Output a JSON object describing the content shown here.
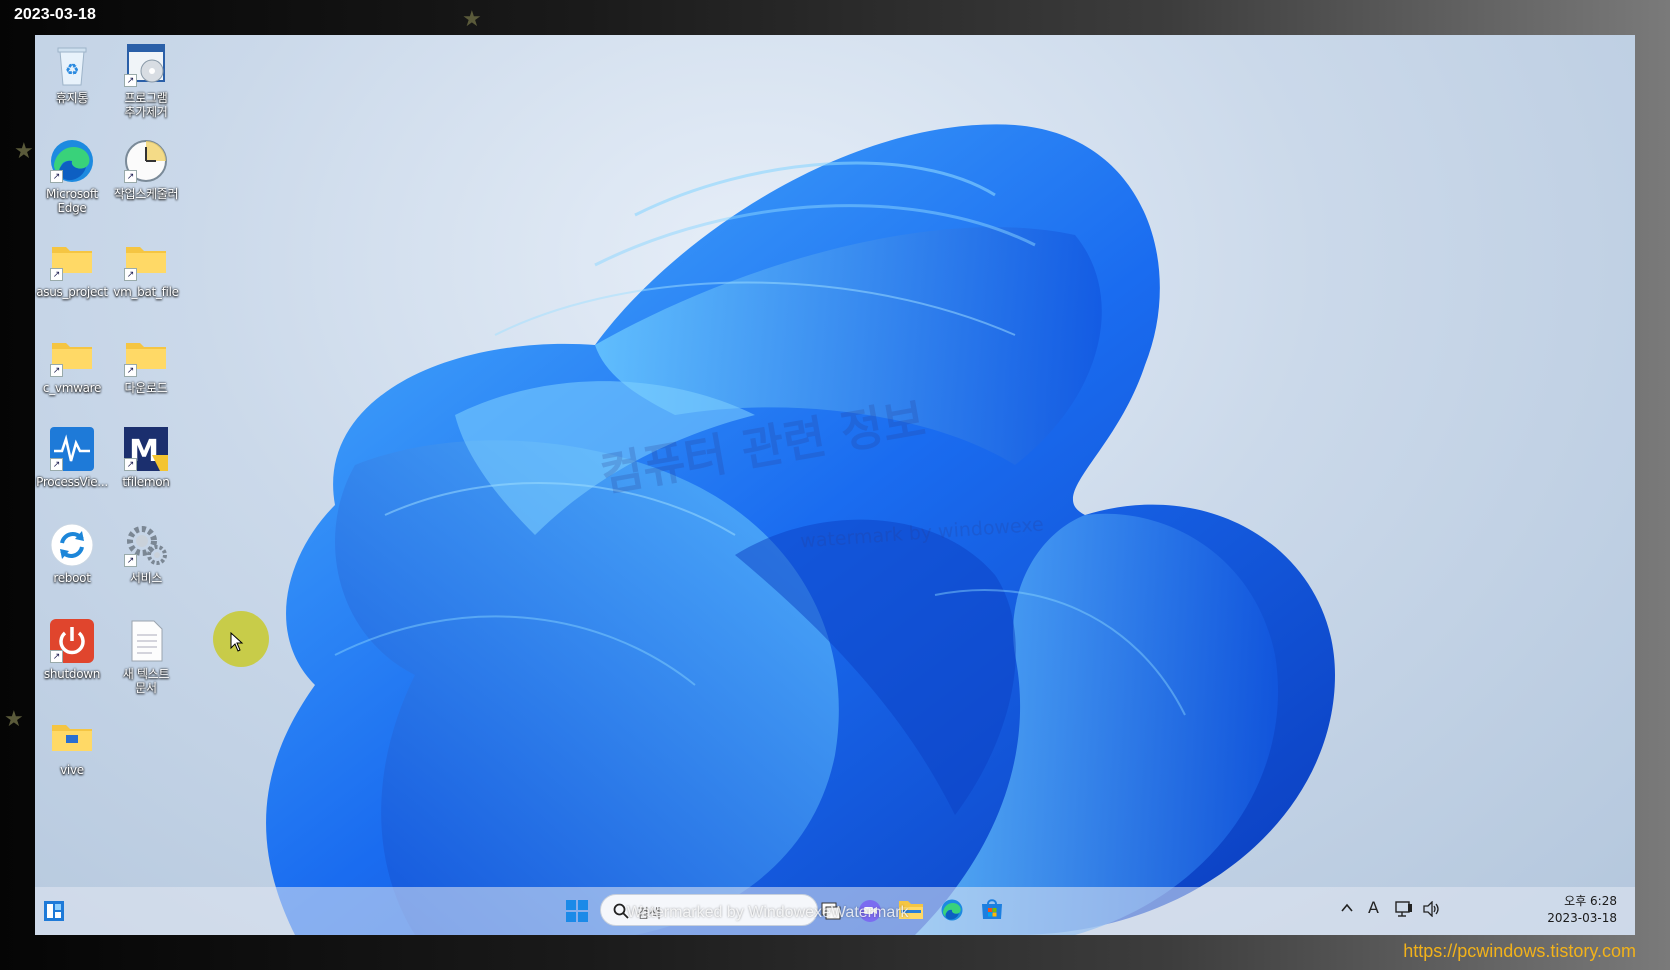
{
  "frame": {
    "date_label": "2023-03-18",
    "source_url": "https://pcwindows.tistory.com"
  },
  "desktop": {
    "watermark_main": "컴퓨터 관련 정보",
    "watermark_sub": "watermark by windowexe",
    "icons": [
      {
        "label": "휴지통",
        "icon": "recycle-bin-icon"
      },
      {
        "label": "프로그램\n추가제거",
        "icon": "programs-features-icon"
      },
      {
        "label": "Microsoft\nEdge",
        "icon": "edge-icon"
      },
      {
        "label": "작업스케줄러",
        "icon": "task-scheduler-icon"
      },
      {
        "label": "asus_project",
        "icon": "folder-icon"
      },
      {
        "label": "vm_bat_file",
        "icon": "folder-icon"
      },
      {
        "label": "c_vmware",
        "icon": "folder-icon"
      },
      {
        "label": "다운로드",
        "icon": "folder-icon"
      },
      {
        "label": "ProcessVie...",
        "icon": "process-viewer-icon"
      },
      {
        "label": "tfilemon",
        "icon": "filemon-icon"
      },
      {
        "label": "reboot",
        "icon": "reboot-icon"
      },
      {
        "label": "서비스",
        "icon": "services-gear-icon"
      },
      {
        "label": "shutdown",
        "icon": "shutdown-icon"
      },
      {
        "label": "새 텍스트\n문서",
        "icon": "text-document-icon"
      },
      {
        "label": "vive",
        "icon": "folder-icon"
      }
    ]
  },
  "taskbar": {
    "search_placeholder": "검색",
    "watermark": "Watermarked by WindowexeWatermark",
    "tray": {
      "ime_label": "A"
    },
    "clock": {
      "time": "오후 6:28",
      "date": "2023-03-18"
    }
  }
}
